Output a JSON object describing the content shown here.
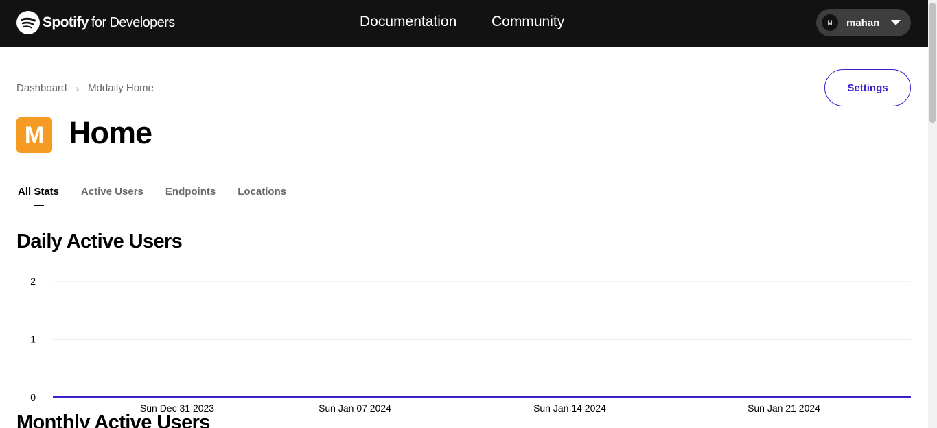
{
  "header": {
    "brand": "Spotify",
    "brand_sub": "for Developers",
    "nav": [
      "Documentation",
      "Community"
    ],
    "user": {
      "initial": "M",
      "name": "mahan"
    }
  },
  "breadcrumb": [
    "Dashboard",
    "Mddaily Home"
  ],
  "settings_label": "Settings",
  "app": {
    "icon_letter": "M",
    "title": "Home"
  },
  "tabs": [
    "All Stats",
    "Active Users",
    "Endpoints",
    "Locations"
  ],
  "sections": {
    "daily": "Daily Active Users",
    "monthly": "Monthly Active Users"
  },
  "colors": {
    "accent": "#3b1fcc",
    "app_icon": "#f59b23",
    "header_bg": "#121212"
  },
  "chart_data": {
    "type": "line",
    "title": "Daily Active Users",
    "x_ticks": [
      "Sun Dec 31 2023",
      "Sun Jan 07 2024",
      "Sun Jan 14 2024",
      "Sun Jan 21 2024"
    ],
    "y_ticks": [
      0,
      1,
      2
    ],
    "ylim": [
      0,
      2
    ],
    "series": [
      {
        "values": [
          0,
          0,
          0,
          0
        ]
      }
    ],
    "grid": true
  }
}
